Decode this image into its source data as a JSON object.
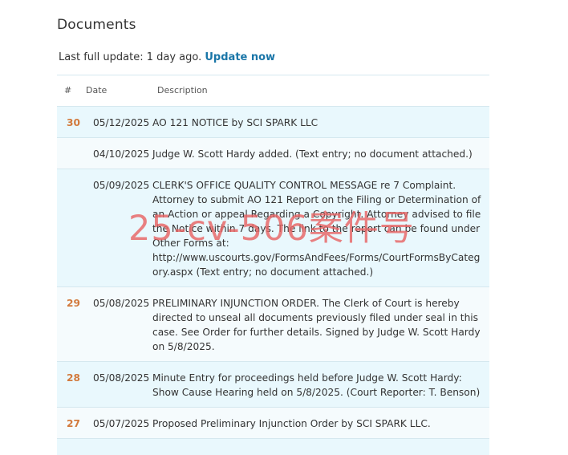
{
  "page": {
    "title": "Documents",
    "update_prefix": "Last full update: 1 day ago.",
    "update_link": "Update now"
  },
  "table": {
    "headers": [
      "#",
      "Date",
      "Description"
    ],
    "rows": [
      {
        "number": "30",
        "date": "05/12/2025",
        "description": "AO 121 NOTICE by SCI SPARK LLC"
      },
      {
        "number": "",
        "date": "04/10/2025",
        "description": "Judge W. Scott Hardy added. (Text entry; no document attached.)"
      },
      {
        "number": "",
        "date": "05/09/2025",
        "description": "CLERK'S OFFICE QUALITY CONTROL MESSAGE re 7 Complaint. Attorney to submit AO 121 Report on the Filing or Determination of an Action or appeal Regarding a Copyright. Attorney advised to file the Notice within 7 days. The link to the report can be found under Other Forms at: http://www.uscourts.gov/FormsAndFees/Forms/CourtFormsByCategory.aspx (Text entry; no document attached.)"
      },
      {
        "number": "29",
        "date": "05/08/2025",
        "description": "PRELIMINARY INJUNCTION ORDER. The Clerk of Court is hereby directed to unseal all documents previously filed under seal in this case. See Order for further details. Signed by Judge W. Scott Hardy on 5/8/2025."
      },
      {
        "number": "28",
        "date": "05/08/2025",
        "description": "Minute Entry for proceedings held before Judge W. Scott Hardy: Show Cause Hearing held on 5/8/2025. (Court Reporter: T. Benson)"
      },
      {
        "number": "27",
        "date": "05/07/2025",
        "description": "Proposed Preliminary Injunction Order by SCI SPARK LLC."
      }
    ]
  },
  "watermark": "25-cv-506案件号"
}
